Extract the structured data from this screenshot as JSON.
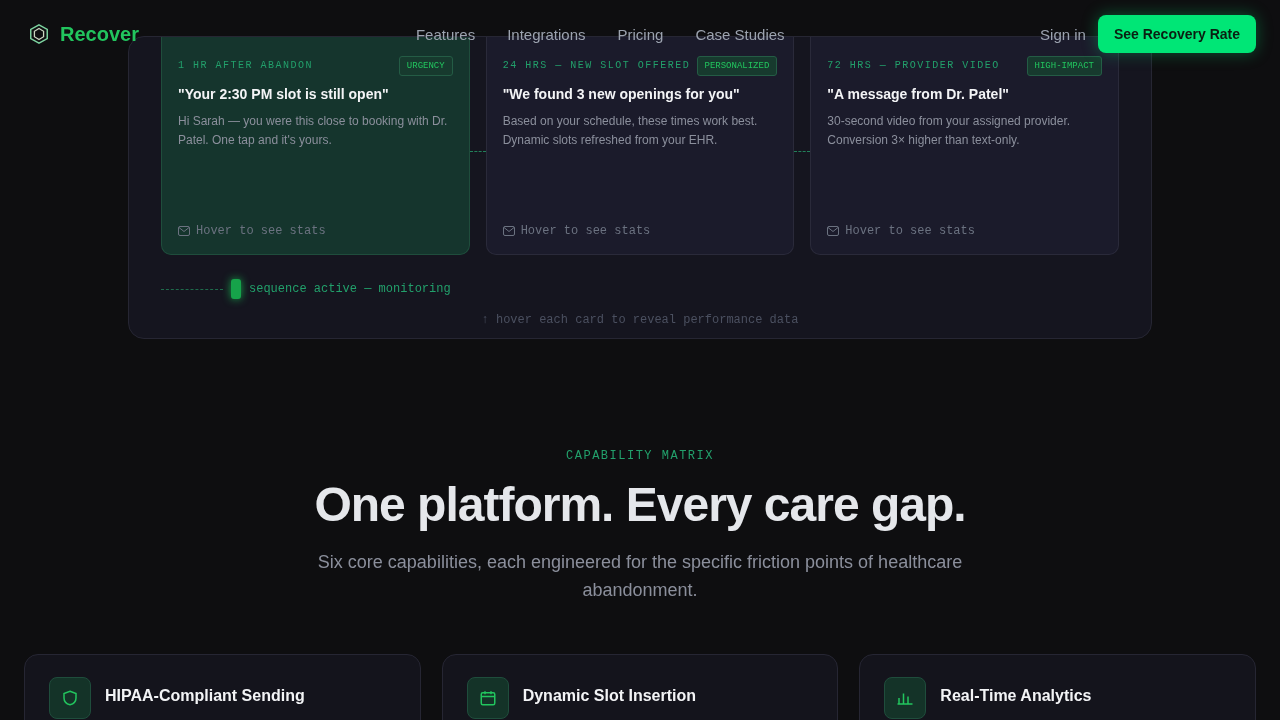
{
  "nav": {
    "brand": "Recover",
    "links": [
      "Features",
      "Integrations",
      "Pricing",
      "Case Studies"
    ],
    "sign_in": "Sign in",
    "cta": "See Recovery Rate"
  },
  "sequence": {
    "steps": [
      {
        "timing": "1 HR AFTER ABANDON",
        "badge": "URGENCY",
        "title": "\"Your 2:30 PM slot is still open\"",
        "body": "Hi Sarah — you were this close to booking with Dr. Patel. One tap and it's yours.",
        "footer": "Hover to see stats",
        "selected": true
      },
      {
        "timing": "24 HRS — NEW SLOT OFFERED",
        "badge": "PERSONALIZED",
        "title": "\"We found 3 new openings for you\"",
        "body": "Based on your schedule, these times work best. Dynamic slots refreshed from your EHR.",
        "footer": "Hover to see stats",
        "selected": false
      },
      {
        "timing": "72 HRS — PROVIDER VIDEO",
        "badge": "HIGH-IMPACT",
        "title": "\"A message from Dr. Patel\"",
        "body": "30-second video from your assigned provider. Conversion 3× higher than text-only.",
        "footer": "Hover to see stats",
        "selected": false
      }
    ],
    "status": "sequence active — monitoring",
    "hint": "↑ hover each card to reveal performance data"
  },
  "capabilities": {
    "eyebrow": "CAPABILITY MATRIX",
    "heading": "One platform. Every care gap.",
    "subtitle": "Six core capabilities, each engineered for the specific friction points of healthcare abandonment.",
    "cards": [
      {
        "kind": "shield",
        "title": "HIPAA-Compliant Sending"
      },
      {
        "kind": "calendar",
        "title": "Dynamic Slot Insertion"
      },
      {
        "kind": "chart",
        "title": "Real-Time Analytics"
      }
    ]
  }
}
